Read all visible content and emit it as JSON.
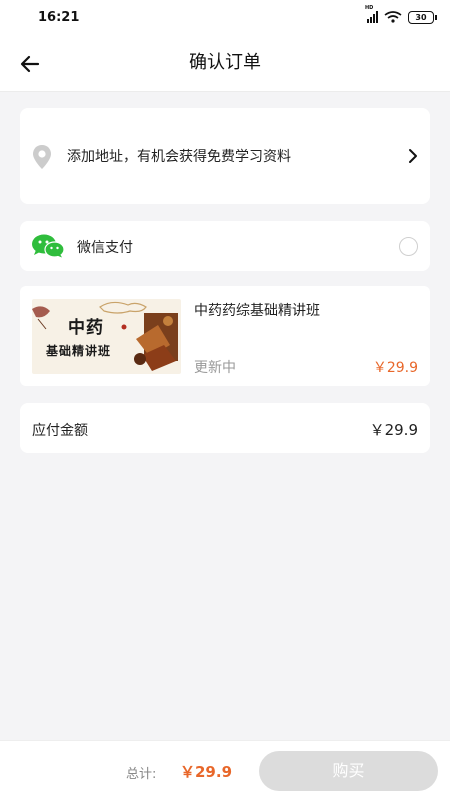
{
  "status_bar": {
    "time": "16:21",
    "network_label": "HD",
    "battery": "30",
    "icons": [
      "signal-icon",
      "wifi-icon",
      "battery-icon"
    ]
  },
  "nav": {
    "title": "确认订单",
    "back_icon": "arrow-left-icon"
  },
  "address": {
    "text": "添加地址，有机会获得免费学习资料",
    "icon": "location-pin-icon",
    "chevron": "chevron-right-icon"
  },
  "payment": {
    "label": "微信支付",
    "icon": "wechat-icon",
    "selected": false
  },
  "course": {
    "thumb_title_line1": "中药",
    "thumb_title_line2": "基础精讲班",
    "title": "中药药综基础精讲班",
    "status": "更新中",
    "price": "￥29.9"
  },
  "order_total": {
    "label": "应付金额",
    "value": "￥29.9"
  },
  "bottom_bar": {
    "sum_label": "总计:",
    "sum_value": "￥29.9",
    "buy_label": "购买"
  },
  "colors": {
    "accent": "#e8672a",
    "background": "#f4f4f6",
    "card": "#ffffff",
    "button_disabled": "#dcdcdc",
    "wechat_green": "#2fbd3c"
  }
}
